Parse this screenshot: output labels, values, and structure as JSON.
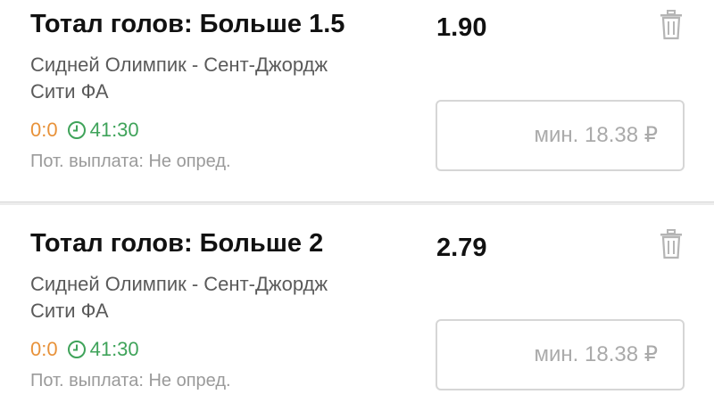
{
  "bets": [
    {
      "market": "Тотал голов: Больше 1.5",
      "odds": "1.90",
      "event_line1": "Сидней Олимпик - Сент-Джордж",
      "event_line2": "Сити ФА",
      "score": "0:0",
      "time": "41:30",
      "payout": "Пот. выплата: Не опред.",
      "stake_placeholder": "мин. 18.38 ₽",
      "delete_icon": "trash-icon",
      "clock_icon": "clock-icon"
    },
    {
      "market": "Тотал голов: Больше 2",
      "odds": "2.79",
      "event_line1": "Сидней Олимпик - Сент-Джордж",
      "event_line2": "Сити ФА",
      "score": "0:0",
      "time": "41:30",
      "payout": "Пот. выплата: Не опред.",
      "stake_placeholder": "мин. 18.38 ₽",
      "delete_icon": "trash-icon",
      "clock_icon": "clock-icon"
    }
  ],
  "colors": {
    "score": "#e8923a",
    "live_time": "#3fa35a",
    "muted_text": "#9a9a9a",
    "event_text": "#5a5a5a",
    "input_border": "#d6d6d6"
  }
}
